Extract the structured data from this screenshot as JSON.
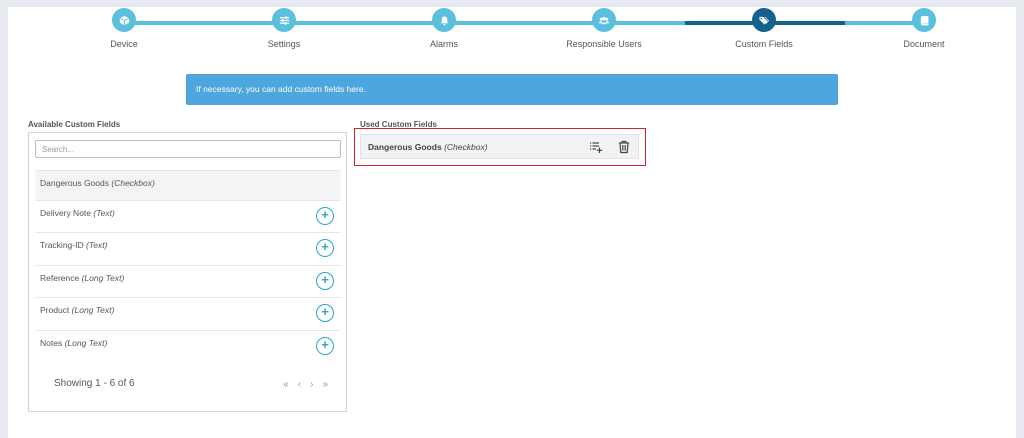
{
  "stepper": {
    "steps": [
      {
        "label": "Device",
        "icon": "cube-icon"
      },
      {
        "label": "Settings",
        "icon": "sliders-icon"
      },
      {
        "label": "Alarms",
        "icon": "bell-icon"
      },
      {
        "label": "Responsible Users",
        "icon": "users-icon"
      },
      {
        "label": "Custom Fields",
        "icon": "tags-icon"
      },
      {
        "label": "Document",
        "icon": "book-icon"
      }
    ],
    "active_index": 4,
    "colors": {
      "done": "#5bc0de",
      "active": "#14618e"
    }
  },
  "info": {
    "text": "If necessary, you can add custom fields here."
  },
  "available": {
    "title": "Available Custom Fields",
    "search_placeholder": "Search...",
    "items": [
      {
        "name": "Dangerous Goods",
        "type": "(Checkbox)"
      },
      {
        "name": "Delivery Note",
        "type": "(Text)"
      },
      {
        "name": "Tracking-ID",
        "type": "(Text)"
      },
      {
        "name": "Reference",
        "type": "(Long Text)"
      },
      {
        "name": "Product",
        "type": "(Long Text)"
      },
      {
        "name": "Notes",
        "type": "(Long Text)"
      }
    ],
    "add_symbol": "+",
    "showing": "Showing 1 - 6 of 6",
    "pager": {
      "first": "«",
      "prev": "‹",
      "next": "›",
      "last": "»"
    }
  },
  "used": {
    "title": "Used Custom Fields",
    "items": [
      {
        "name": "Dangerous Goods",
        "type_open": "(",
        "type": "Checkbox",
        "type_close": ")"
      }
    ]
  },
  "colors": {
    "accent": "#2aa7cf",
    "info_bg": "#4ea6df",
    "highlight": "#d6212f"
  }
}
